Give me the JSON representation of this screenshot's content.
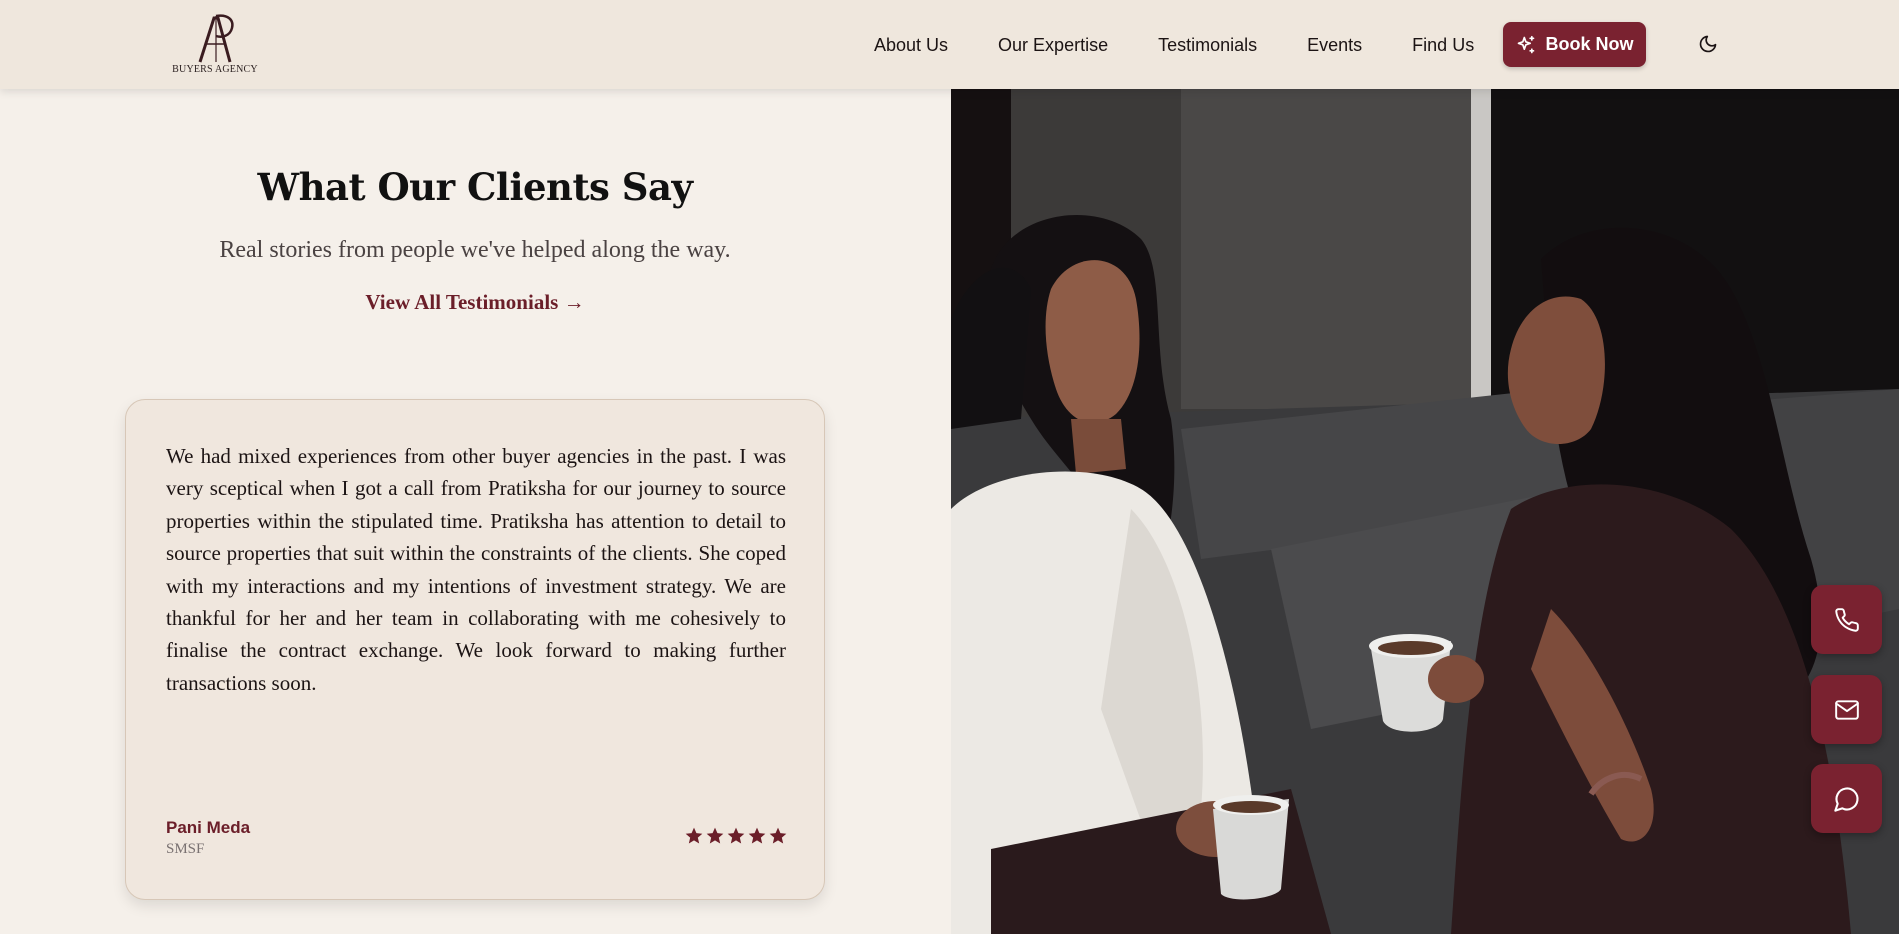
{
  "header": {
    "logo_text": "BUYERS AGENCY",
    "nav": [
      {
        "label": "About Us"
      },
      {
        "label": "Our Expertise"
      },
      {
        "label": "Testimonials"
      },
      {
        "label": "Events"
      },
      {
        "label": "Find Us"
      }
    ],
    "book_label": "Book Now",
    "theme_icon": "moon-icon"
  },
  "testimonials": {
    "title": "What Our Clients Say",
    "subtitle": "Real stories from people we've helped along the way.",
    "view_all": "View All Testimonials →",
    "card": {
      "quote": "We had mixed experiences from other buyer agencies in the past. I was very sceptical when I got a call from Pratiksha for our journey to source properties within the stipulated time. Pratiksha has attention to detail to source properties that suit within the constraints of the clients. She coped with my interactions and my intentions of investment strategy. We are thankful for her and her team in collaborating with me cohesively to finalise the contract exchange. We look forward to making further transactions soon.",
      "author": "Pani Meda",
      "role": "SMSF",
      "rating": 5
    }
  },
  "contact": [
    {
      "icon": "phone-icon"
    },
    {
      "icon": "mail-icon"
    },
    {
      "icon": "chat-icon"
    }
  ],
  "colors": {
    "accent": "#7a2230",
    "background": "#f5f0ea",
    "header_bg": "#efe7dd",
    "card_bg": "#f0e7de"
  }
}
